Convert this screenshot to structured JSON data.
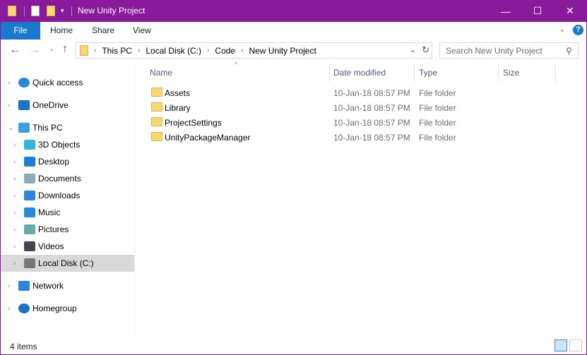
{
  "window": {
    "title": "New Unity Project",
    "minimize": "—",
    "maximize": "☐",
    "close": "✕"
  },
  "ribbon": {
    "tabs": [
      "File",
      "Home",
      "Share",
      "View"
    ],
    "help": "?",
    "expand": "⌄"
  },
  "nav": {
    "back": "←",
    "forward": "→",
    "recent": "⌄",
    "up": "↑",
    "breadcrumb": [
      "This PC",
      "Local Disk (C:)",
      "Code",
      "New Unity Project"
    ],
    "refresh": "↻",
    "search_placeholder": "Search New Unity Project"
  },
  "sidebar": [
    {
      "label": "Quick access",
      "icon": "star-icon",
      "color": "#2b88d8"
    },
    {
      "label": "OneDrive",
      "icon": "cloud-icon",
      "color": "#1a73c8"
    },
    {
      "label": "This PC",
      "icon": "monitor-icon",
      "color": "#3aa0e0"
    },
    {
      "label": "3D Objects",
      "icon": "cube-icon",
      "color": "#33b6d6"
    },
    {
      "label": "Desktop",
      "icon": "desktop-icon",
      "color": "#1f7fd8"
    },
    {
      "label": "Documents",
      "icon": "document-icon",
      "color": "#8ab"
    },
    {
      "label": "Downloads",
      "icon": "download-icon",
      "color": "#2b88d8"
    },
    {
      "label": "Music",
      "icon": "music-icon",
      "color": "#2b88d8"
    },
    {
      "label": "Pictures",
      "icon": "pictures-icon",
      "color": "#6aa"
    },
    {
      "label": "Videos",
      "icon": "videos-icon",
      "color": "#445"
    },
    {
      "label": "Local Disk (C:)",
      "icon": "drive-icon",
      "color": "#777"
    },
    {
      "label": "Network",
      "icon": "network-icon",
      "color": "#2b88d8"
    },
    {
      "label": "Homegroup",
      "icon": "homegroup-icon",
      "color": "#1a73c8"
    }
  ],
  "columns": [
    "Name",
    "Date modified",
    "Type",
    "Size"
  ],
  "files": [
    {
      "name": "Assets",
      "date": "10-Jan-18 08:57 PM",
      "type": "File folder"
    },
    {
      "name": "Library",
      "date": "10-Jan-18 08:57 PM",
      "type": "File folder"
    },
    {
      "name": "ProjectSettings",
      "date": "10-Jan-18 08:57 PM",
      "type": "File folder"
    },
    {
      "name": "UnityPackageManager",
      "date": "10-Jan-18 08:57 PM",
      "type": "File folder"
    }
  ],
  "status": {
    "count": "4 items"
  }
}
